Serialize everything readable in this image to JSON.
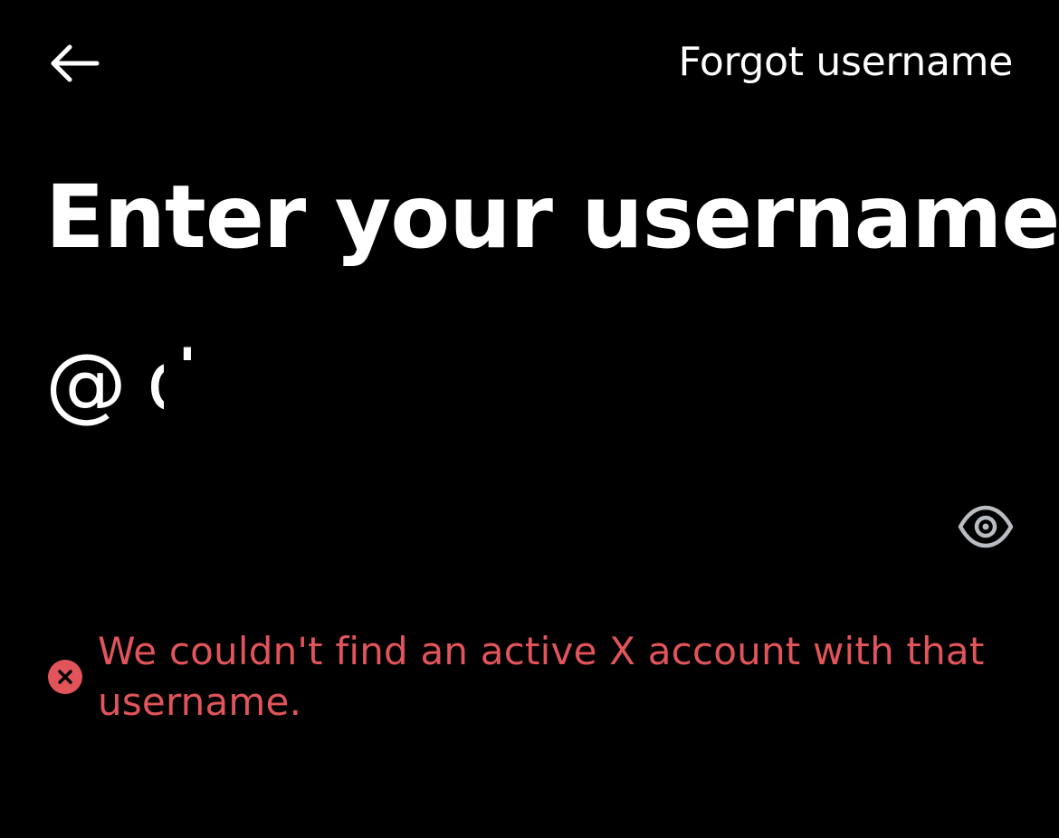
{
  "header": {
    "back_icon": "arrow-left-icon",
    "forgot_label": "Forgot username"
  },
  "main": {
    "title": "Enter your username",
    "username_prefix": "@",
    "username_visible_start": "d",
    "visibility_icon": "eye-icon"
  },
  "error": {
    "icon": "error-x-icon",
    "message": "We couldn't find an active X account with that username."
  },
  "colors": {
    "background": "#000000",
    "text": "#ffffff",
    "error": "#e0545a",
    "icon_muted": "#b9bcc0"
  }
}
